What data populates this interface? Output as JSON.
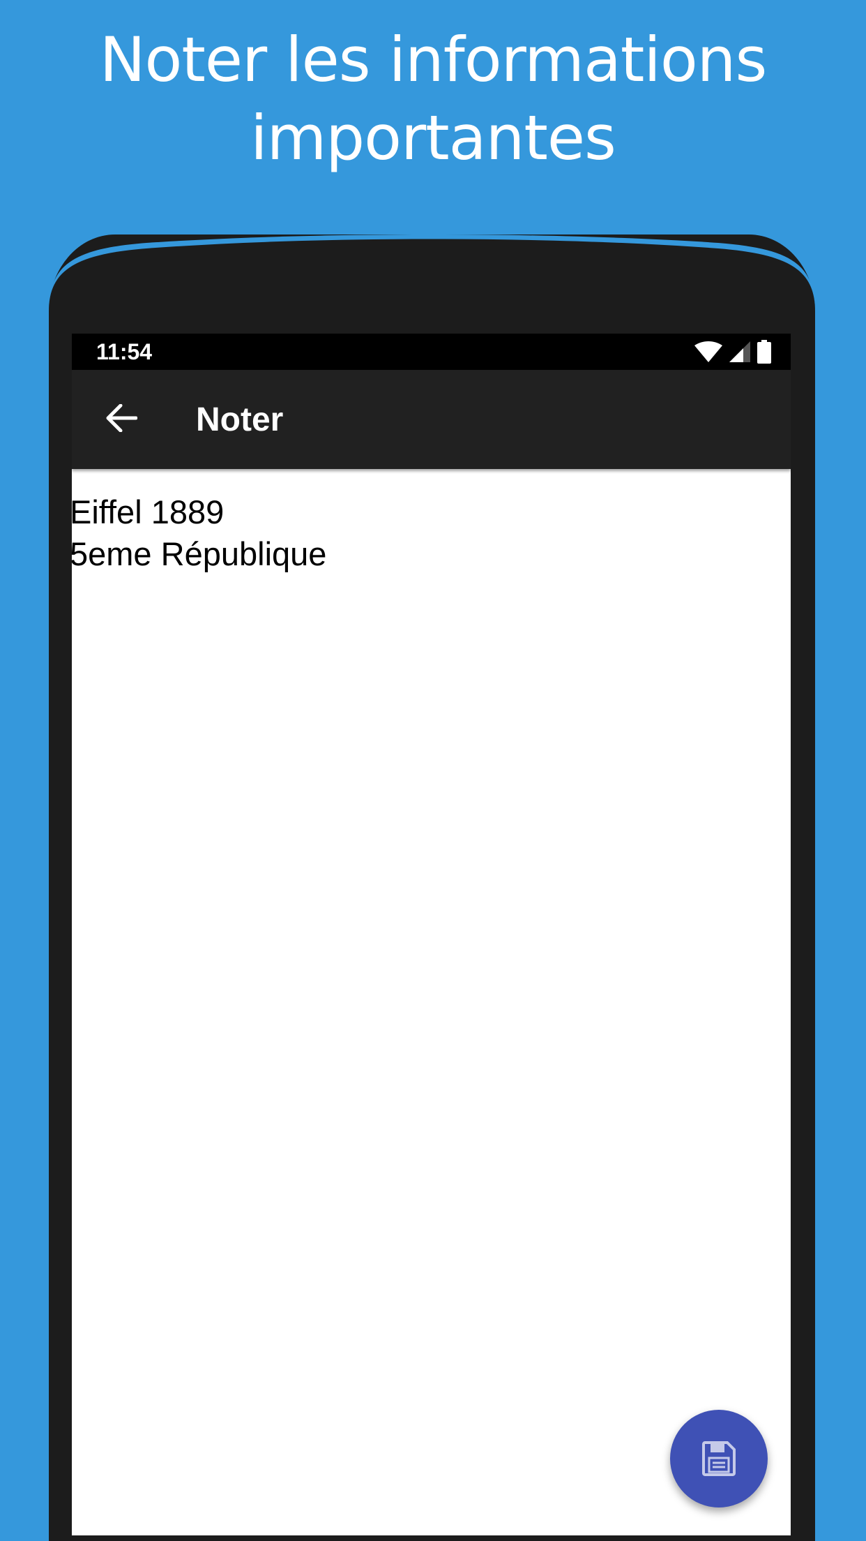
{
  "headline": {
    "line1": "Noter les informations",
    "line2": "importantes"
  },
  "status_bar": {
    "time": "11:54",
    "icons": [
      "wifi-icon",
      "cell-signal-icon",
      "battery-icon"
    ]
  },
  "app_bar": {
    "back_icon": "arrow-back-icon",
    "title": "Noter"
  },
  "note": {
    "text": "Eiffel 1889\n5eme République"
  },
  "fab": {
    "icon": "save-icon"
  },
  "colors": {
    "background": "#3598dc",
    "phone_body": "#1c1c1c",
    "status_bar": "#000000",
    "app_bar": "#212121",
    "fab": "#3f51b5"
  }
}
